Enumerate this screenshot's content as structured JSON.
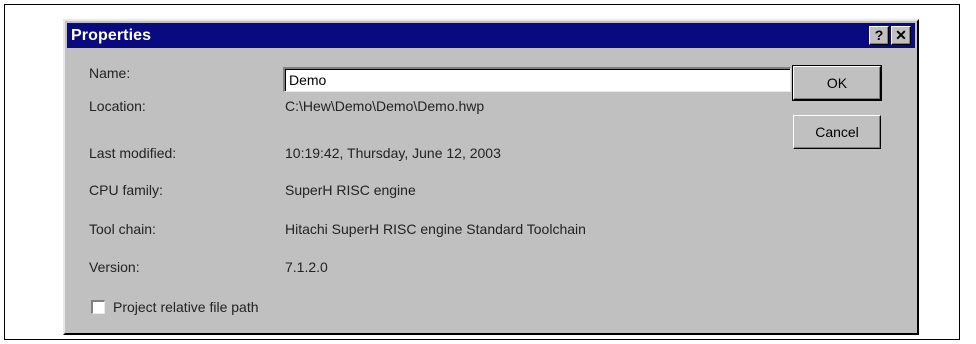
{
  "dialog": {
    "title": "Properties",
    "help_label": "?",
    "close_label": "✕"
  },
  "fields": {
    "name_label": "Name:",
    "name_value": "Demo",
    "location_label": "Location:",
    "location_value": "C:\\Hew\\Demo\\Demo\\Demo.hwp",
    "modified_label": "Last modified:",
    "modified_value": "10:19:42, Thursday, June 12, 2003",
    "cpu_label": "CPU family:",
    "cpu_value": "SuperH RISC engine",
    "toolchain_label": "Tool chain:",
    "toolchain_value": "Hitachi SuperH RISC engine Standard Toolchain",
    "version_label": "Version:",
    "version_value": "7.1.2.0"
  },
  "buttons": {
    "ok_label": "OK",
    "cancel_label": "Cancel"
  },
  "options": {
    "relative_path_label": "Project relative file path",
    "relative_path_checked": false
  }
}
